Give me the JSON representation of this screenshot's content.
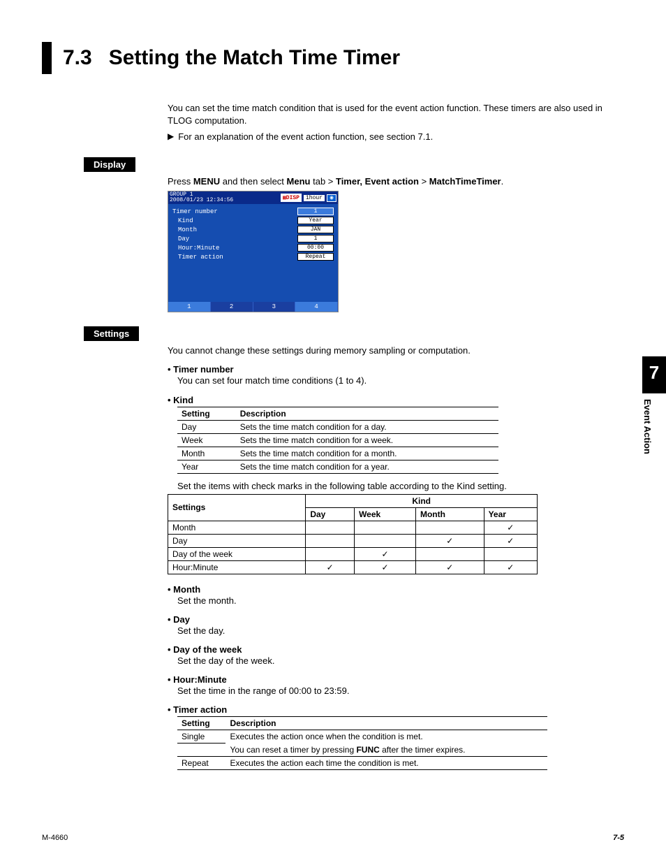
{
  "header": {
    "section_number": "7.3",
    "section_title": "Setting the Match Time Timer"
  },
  "intro": {
    "p1": "You can set the time match condition that is used for the event action function. These timers are also used in TLOG computation.",
    "ref": "For an explanation of the event action function, see section 7.1."
  },
  "display_label": "Display",
  "nav": {
    "prefix": "Press ",
    "menu1": "MENU",
    "mid1": " and then select ",
    "menu2": "Menu",
    "mid2": " tab > ",
    "item1": "Timer, Event action",
    "mid3": " > ",
    "item2": "MatchTimeTimer",
    "suffix": "."
  },
  "screenshot": {
    "group": "GROUP 1",
    "timestamp": "2008/01/23 12:34:56",
    "disp": "DISP",
    "one_hour": "1hour",
    "rows": {
      "timer_number": {
        "label": "Timer number",
        "value": "1"
      },
      "kind": {
        "label": "Kind",
        "value": "Year"
      },
      "month": {
        "label": "Month",
        "value": "JAN"
      },
      "day": {
        "label": "Day",
        "value": "1"
      },
      "hour_minute": {
        "label": "Hour:Minute",
        "value": "00:00"
      },
      "timer_action": {
        "label": "Timer action",
        "value": "Repeat"
      }
    },
    "tabs": [
      "1",
      "2",
      "3",
      "4"
    ]
  },
  "settings_label": "Settings",
  "settings_note": "You cannot change these settings during memory sampling or computation.",
  "items": {
    "timer_number": {
      "head": "Timer number",
      "desc": "You can set four match time conditions (1 to 4)."
    },
    "kind": {
      "head": "Kind",
      "th_setting": "Setting",
      "th_desc": "Description",
      "rows": [
        {
          "s": "Day",
          "d": "Sets the time match condition for a day."
        },
        {
          "s": "Week",
          "d": "Sets the time match condition for a week."
        },
        {
          "s": "Month",
          "d": "Sets the time match condition for a month."
        },
        {
          "s": "Year",
          "d": "Sets the time match condition for a year."
        }
      ],
      "note_after": "Set the items with check marks in the following table according to the Kind setting.",
      "matrix": {
        "th_settings": "Settings",
        "th_kind": "Kind",
        "cols": [
          "Day",
          "Week",
          "Month",
          "Year"
        ],
        "rows": [
          {
            "label": "Month",
            "marks": [
              "",
              "",
              "",
              "✓"
            ]
          },
          {
            "label": "Day",
            "marks": [
              "",
              "",
              "✓",
              "✓"
            ]
          },
          {
            "label": "Day of the week",
            "marks": [
              "",
              "✓",
              "",
              ""
            ]
          },
          {
            "label": "Hour:Minute",
            "marks": [
              "✓",
              "✓",
              "✓",
              "✓"
            ]
          }
        ]
      }
    },
    "month": {
      "head": "Month",
      "desc": "Set the month."
    },
    "day": {
      "head": "Day",
      "desc": "Set the day."
    },
    "dow": {
      "head": "Day of the week",
      "desc": "Set the day of the week."
    },
    "hm": {
      "head": "Hour:Minute",
      "desc": "Set the time in the range of 00:00 to 23:59."
    },
    "timer_action": {
      "head": "Timer action",
      "th_setting": "Setting",
      "th_desc": "Description",
      "rows": [
        {
          "s": "Single",
          "d1": "Executes the action once when the condition is met.",
          "d2a": "You can reset a timer by pressing ",
          "func": "FUNC",
          "d2b": " after the timer expires."
        },
        {
          "s": "Repeat",
          "d": "Executes the action each time the condition is met."
        }
      ]
    }
  },
  "side": {
    "chapter": "7",
    "label": "Event Action"
  },
  "footer": {
    "left": "M-4660",
    "right": "7-5"
  }
}
